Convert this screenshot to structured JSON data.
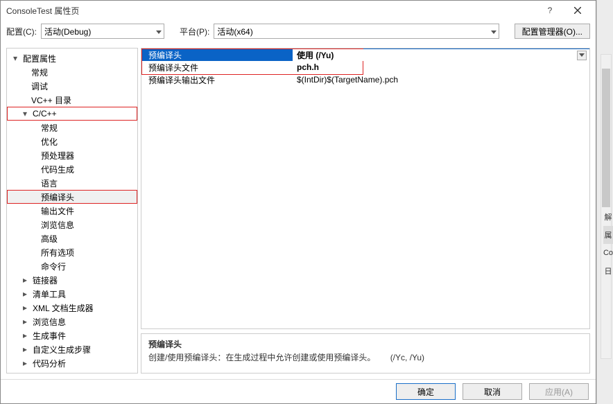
{
  "title": "ConsoleTest 属性页",
  "config_row": {
    "config_label": "配置(C):",
    "config_value": "活动(Debug)",
    "platform_label": "平台(P):",
    "platform_value": "活动(x64)",
    "manager_button": "配置管理器(O)..."
  },
  "tree": {
    "root": "配置属性",
    "items": {
      "general": "常规",
      "debug": "调试",
      "vcdirs": "VC++ 目录",
      "ccpp": "C/C++",
      "ccpp_children": {
        "general": "常规",
        "optimize": "优化",
        "preproc": "预处理器",
        "codegen": "代码生成",
        "lang": "语言",
        "pch": "预编译头",
        "output": "输出文件",
        "browse": "浏览信息",
        "advanced": "高级",
        "allopts": "所有选项",
        "cmdline": "命令行"
      },
      "linker": "链接器",
      "manifest": "清单工具",
      "xmldoc": "XML 文档生成器",
      "browseinfo": "浏览信息",
      "buildevents": "生成事件",
      "custombuild": "自定义生成步骤",
      "codeanalysis": "代码分析"
    }
  },
  "grid": {
    "rows": [
      {
        "name": "预编译头",
        "value": "使用 (/Yu)"
      },
      {
        "name": "预编译头文件",
        "value": "pch.h"
      },
      {
        "name": "预编译头输出文件",
        "value": "$(IntDir)$(TargetName).pch"
      }
    ]
  },
  "desc": {
    "title": "预编译头",
    "body": "创建/使用预编译头：在生成过程中允许创建或使用预编译头。",
    "flags": "(/Yc, /Yu)"
  },
  "footer": {
    "ok": "确定",
    "cancel": "取消",
    "apply": "应用(A)"
  },
  "side": {
    "a": "解",
    "b": "属",
    "c": "Co",
    "d": "日"
  }
}
